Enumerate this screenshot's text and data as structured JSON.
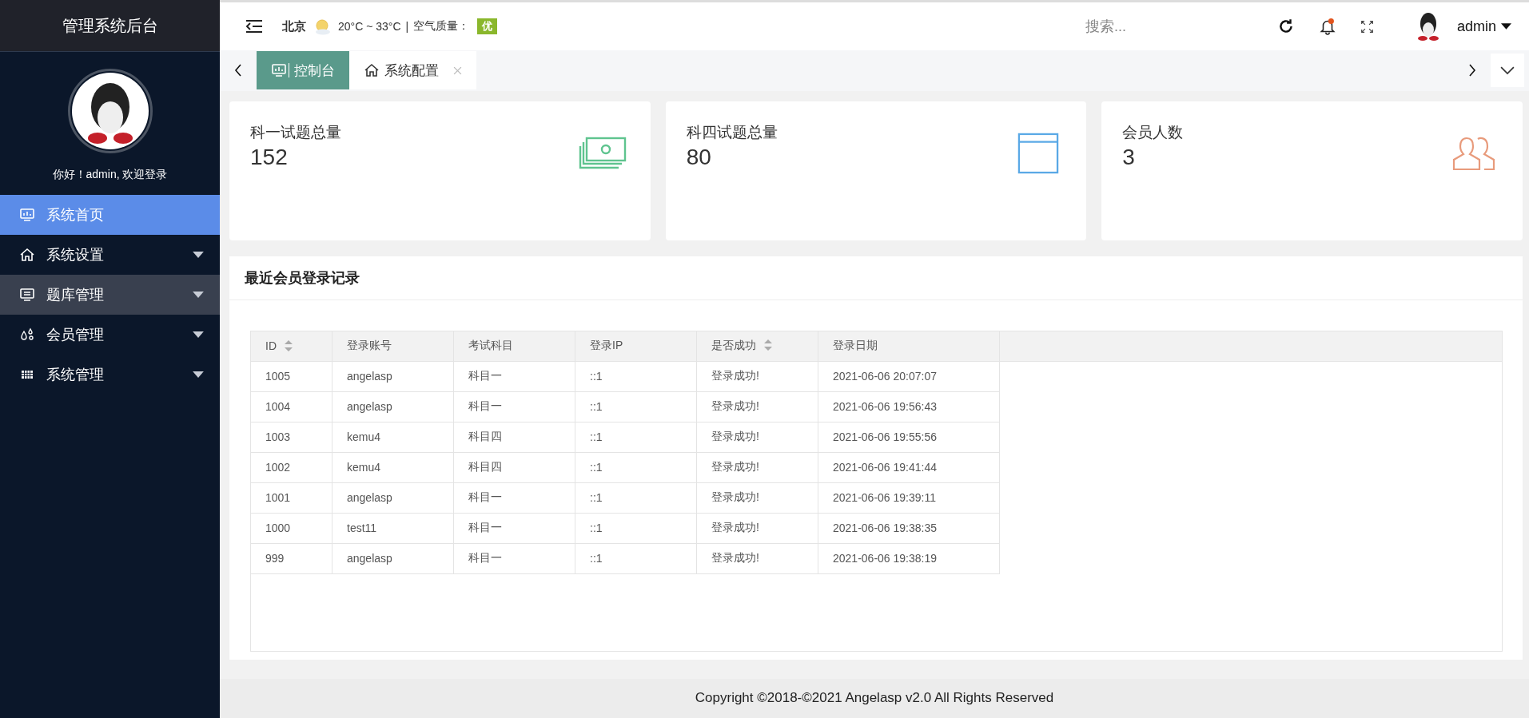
{
  "sidebar": {
    "title": "管理系统后台",
    "greeting": "你好！admin, 欢迎登录",
    "items": [
      {
        "label": "系统首页",
        "selected": true,
        "hovered": false,
        "has_submenu": false
      },
      {
        "label": "系统设置",
        "selected": false,
        "hovered": false,
        "has_submenu": true
      },
      {
        "label": "题库管理",
        "selected": false,
        "hovered": true,
        "has_submenu": true
      },
      {
        "label": "会员管理",
        "selected": false,
        "hovered": false,
        "has_submenu": true
      },
      {
        "label": "系统管理",
        "selected": false,
        "hovered": false,
        "has_submenu": true
      }
    ]
  },
  "topbar": {
    "city": "北京",
    "temperature": "20°C ~ 33°C",
    "separator": "|",
    "air_label": "空气质量：",
    "air_quality": "优",
    "search": {
      "placeholder": "搜索..."
    },
    "notification": true,
    "user": "admin"
  },
  "tabs": [
    {
      "label": "控制台",
      "selected": true,
      "closable": false
    },
    {
      "label": "系统配置",
      "selected": false,
      "closable": true
    }
  ],
  "stats": [
    {
      "label": "科一试题总量",
      "value": "152",
      "color": "#5fc48f"
    },
    {
      "label": "科四试题总量",
      "value": "80",
      "color": "#5aa9e6"
    },
    {
      "label": "会员人数",
      "value": "3",
      "color": "#e89b7c"
    }
  ],
  "table": {
    "title": "最近会员登录记录",
    "columns": [
      {
        "label": "ID",
        "sortable": true
      },
      {
        "label": "登录账号",
        "sortable": false
      },
      {
        "label": "考试科目",
        "sortable": false
      },
      {
        "label": "登录IP",
        "sortable": false
      },
      {
        "label": "是否成功",
        "sortable": true
      },
      {
        "label": "登录日期",
        "sortable": false
      }
    ],
    "rows": [
      [
        "1005",
        "angelasp",
        "科目一",
        "::1",
        "登录成功!",
        "2021-06-06 20:07:07"
      ],
      [
        "1004",
        "angelasp",
        "科目一",
        "::1",
        "登录成功!",
        "2021-06-06 19:56:43"
      ],
      [
        "1003",
        "kemu4",
        "科目四",
        "::1",
        "登录成功!",
        "2021-06-06 19:55:56"
      ],
      [
        "1002",
        "kemu4",
        "科目四",
        "::1",
        "登录成功!",
        "2021-06-06 19:41:44"
      ],
      [
        "1001",
        "angelasp",
        "科目一",
        "::1",
        "登录成功!",
        "2021-06-06 19:39:11"
      ],
      [
        "1000",
        "test11",
        "科目一",
        "::1",
        "登录成功!",
        "2021-06-06 19:38:35"
      ],
      [
        "999",
        "angelasp",
        "科目一",
        "::1",
        "登录成功!",
        "2021-06-06 19:38:19"
      ]
    ]
  },
  "footer": "Copyright ©2018-©2021 Angelasp v2.0 All Rights Reserved"
}
